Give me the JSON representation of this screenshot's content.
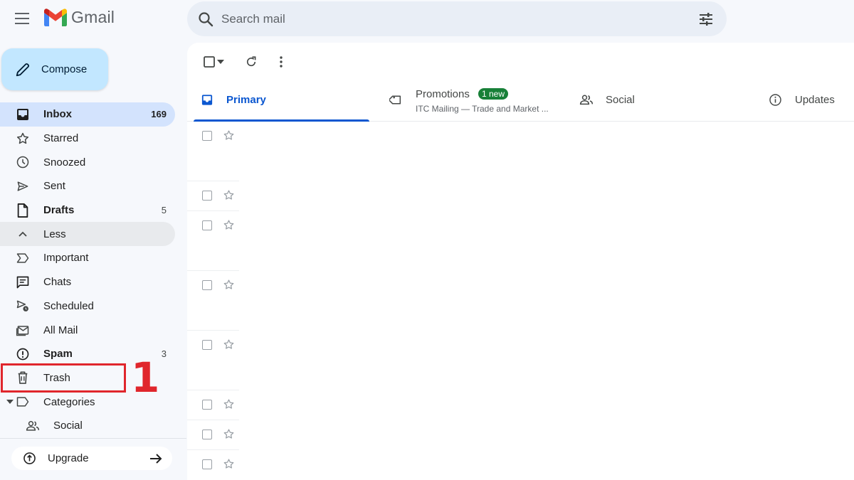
{
  "app": {
    "logo_text": "Gmail",
    "colors": {
      "accent": "#0b57d0",
      "compose_bg": "#c2e7ff",
      "active_bg": "#d3e3fd",
      "badge_green": "#188038",
      "annotation_red": "#e0262c"
    }
  },
  "search": {
    "placeholder": "Search mail",
    "icon": "search-icon",
    "options_icon": "tune-icon"
  },
  "compose": {
    "label": "Compose",
    "icon": "pencil-icon"
  },
  "sidebar": {
    "items": [
      {
        "label": "Inbox",
        "count": "169",
        "icon": "inbox-icon",
        "active": true,
        "bold": true
      },
      {
        "label": "Starred",
        "count": "",
        "icon": "star-icon"
      },
      {
        "label": "Snoozed",
        "count": "",
        "icon": "clock-icon"
      },
      {
        "label": "Sent",
        "count": "",
        "icon": "send-icon"
      },
      {
        "label": "Drafts",
        "count": "5",
        "icon": "draft-icon",
        "bold": true
      },
      {
        "label": "Less",
        "count": "",
        "icon": "chevron-up-icon"
      },
      {
        "label": "Important",
        "count": "",
        "icon": "important-icon"
      },
      {
        "label": "Chats",
        "count": "",
        "icon": "chat-icon"
      },
      {
        "label": "Scheduled",
        "count": "",
        "icon": "scheduled-send-icon"
      },
      {
        "label": "All Mail",
        "count": "",
        "icon": "all-mail-icon"
      },
      {
        "label": "Spam",
        "count": "3",
        "icon": "spam-icon",
        "bold": true
      },
      {
        "label": "Trash",
        "count": "",
        "icon": "trash-icon"
      },
      {
        "label": "Categories",
        "count": "",
        "icon": "label-icon"
      },
      {
        "label": "Social",
        "count": "",
        "icon": "people-icon"
      }
    ],
    "annotation": "1",
    "upgrade_label": "Upgrade"
  },
  "tabs": [
    {
      "label": "Primary",
      "icon": "inbox-icon"
    },
    {
      "label": "Promotions",
      "icon": "tag-icon",
      "badge": "1 new",
      "sub": "ITC Mailing — Trade and Market ..."
    },
    {
      "label": "Social",
      "icon": "people-icon"
    },
    {
      "label": "Updates",
      "icon": "info-icon"
    }
  ],
  "email_rows_visible": 8
}
